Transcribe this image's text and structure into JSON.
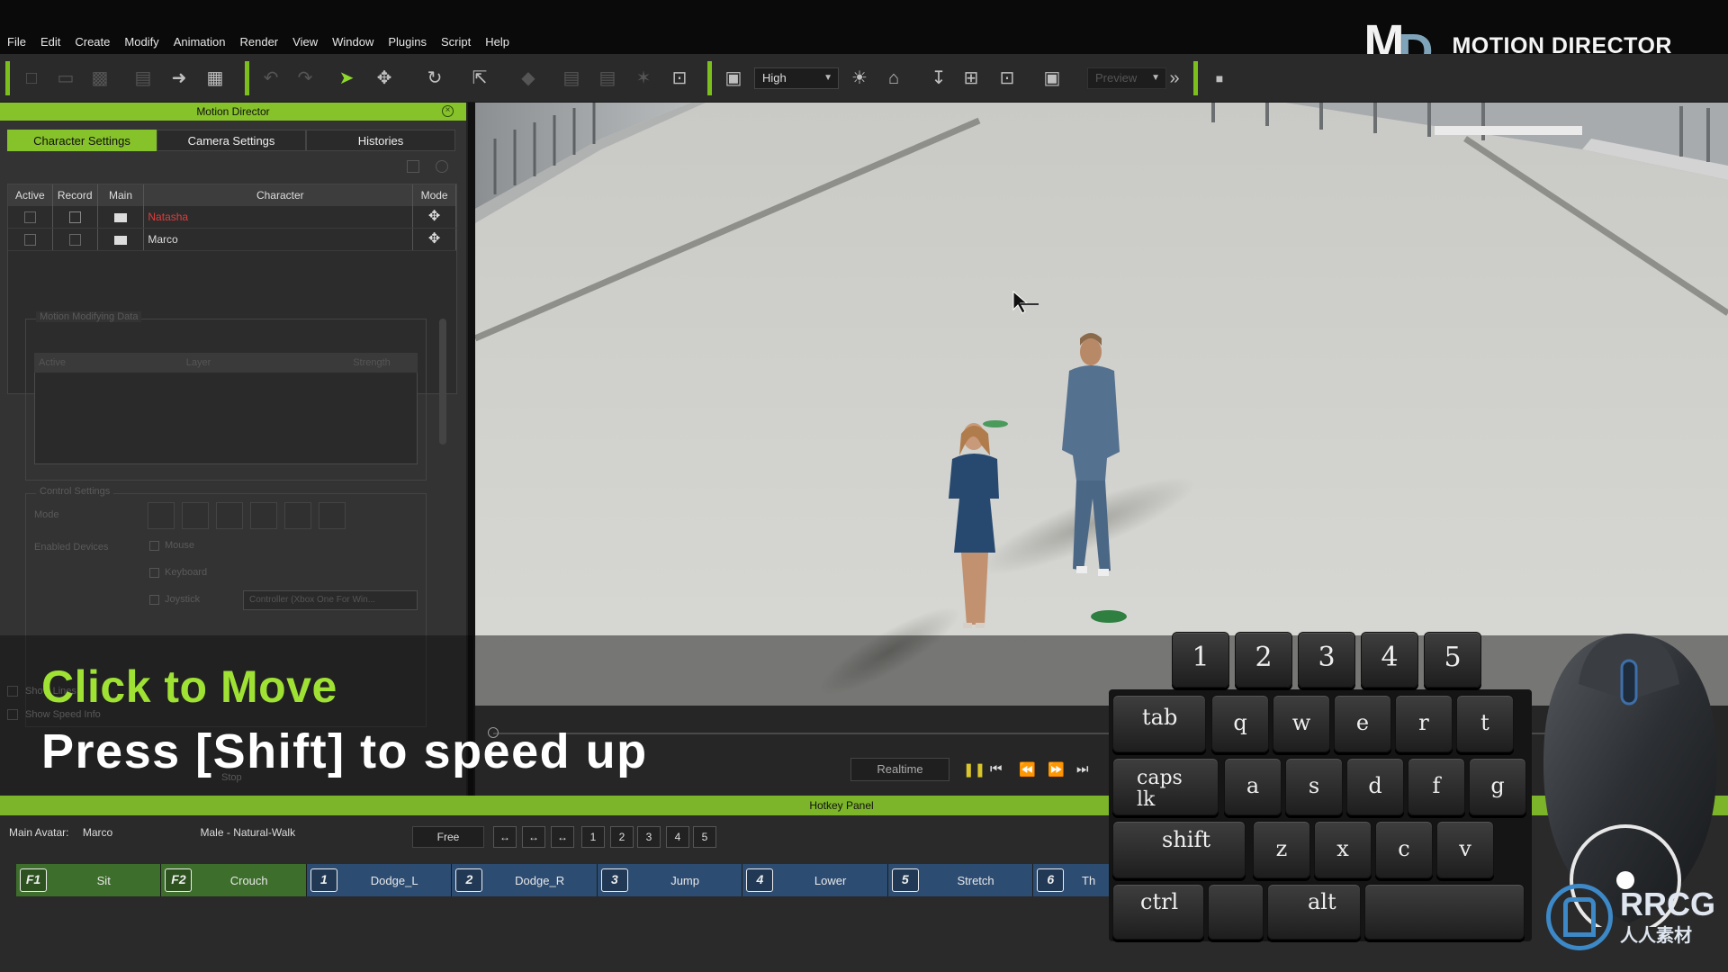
{
  "menu": [
    "File",
    "Edit",
    "Create",
    "Modify",
    "Animation",
    "Render",
    "View",
    "Window",
    "Plugins",
    "Script",
    "Help"
  ],
  "brand": {
    "logo_m": "M",
    "logo_d": "D",
    "name": "MOTION DIRECTOR"
  },
  "toolbar": {
    "quality_value": "High",
    "preview_value": "Preview"
  },
  "panel": {
    "title": "Motion Director",
    "tabs": [
      "Character Settings",
      "Camera Settings",
      "Histories"
    ],
    "grid": {
      "headers": [
        "Active",
        "Record",
        "Main",
        "Character",
        "Mode"
      ],
      "rows": [
        {
          "character": "Natasha"
        },
        {
          "character": "Marco"
        }
      ]
    },
    "motion_group": "Motion Modifying Data",
    "motion_headers": [
      "Active",
      "Layer",
      "Strength"
    ],
    "control_group": "Control Settings",
    "mode_label": "Mode",
    "enabled_devices_label": "Enabled Devices",
    "devices": [
      "Mouse",
      "Keyboard",
      "Joystick"
    ],
    "joystick_option": "Controller (Xbox One For Win...",
    "show_checks": [
      "Show Lines",
      "Show Speed Info"
    ],
    "stop_label": "Stop"
  },
  "captions": {
    "line1": "Click to Move",
    "line2": "Press [Shift] to speed up"
  },
  "playback": {
    "realtime": "Realtime"
  },
  "hotkey": {
    "title": "Hotkey Panel",
    "main_avatar_label": "Main Avatar:",
    "main_avatar_value": "Marco",
    "style": "Male - Natural-Walk",
    "free_label": "Free",
    "pages": [
      "1",
      "2",
      "3",
      "4",
      "5"
    ],
    "items": [
      {
        "key": "F1",
        "label": "Sit"
      },
      {
        "key": "F2",
        "label": "Crouch"
      },
      {
        "key": "1",
        "label": "Dodge_L"
      },
      {
        "key": "2",
        "label": "Dodge_R"
      },
      {
        "key": "3",
        "label": "Jump"
      },
      {
        "key": "4",
        "label": "Lower"
      },
      {
        "key": "5",
        "label": "Stretch"
      },
      {
        "key": "6",
        "label": "Th"
      }
    ]
  },
  "keyboard": {
    "numbers": [
      "1",
      "2",
      "3",
      "4",
      "5"
    ],
    "row_q": [
      "q",
      "w",
      "e",
      "r",
      "t"
    ],
    "row_a": [
      "a",
      "s",
      "d",
      "f",
      "g"
    ],
    "row_z": [
      "z",
      "x",
      "c",
      "v"
    ],
    "tab": "tab",
    "caps1": "caps",
    "caps2": "lk",
    "shift": "shift",
    "ctrl": "ctrl",
    "alt": "alt"
  },
  "watermark": {
    "text": "RRCG",
    "sub": "人人素材"
  },
  "colors": {
    "accent_green": "#86c22a",
    "caption_green": "#9fe234",
    "natasha_red": "#e23b3b"
  }
}
